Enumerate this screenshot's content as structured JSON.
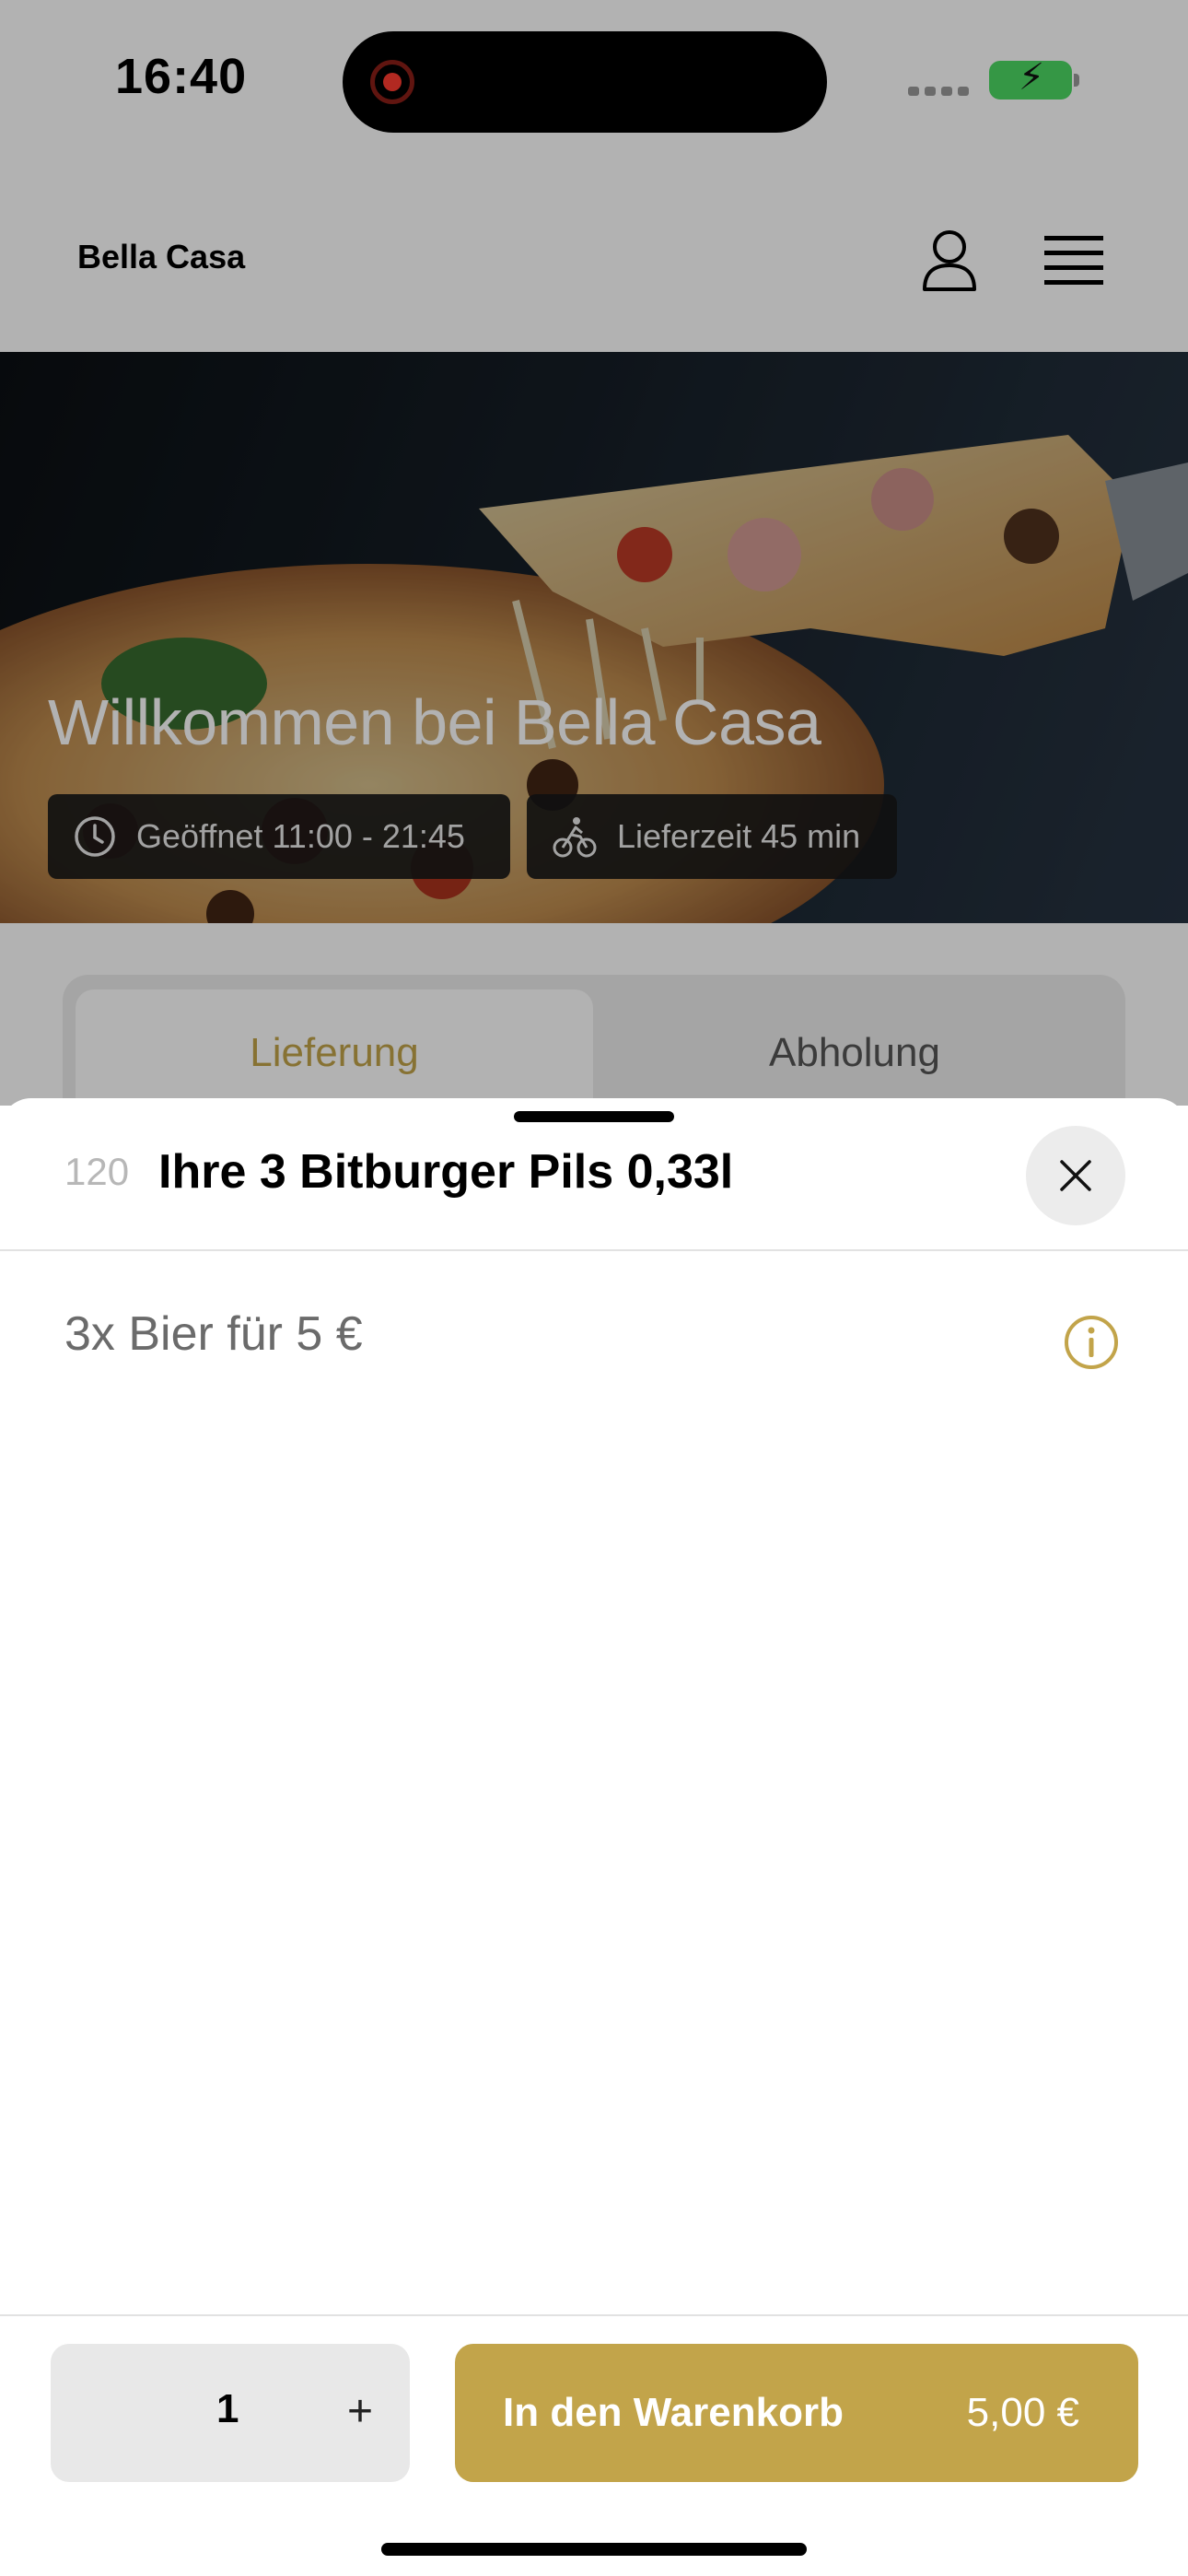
{
  "status_bar": {
    "time": "16:40",
    "recording_icon": "record-icon",
    "battery_icon": "battery-charging-icon"
  },
  "header": {
    "brand": "Bella Casa",
    "account_icon": "user-icon",
    "menu_icon": "menu-icon"
  },
  "hero": {
    "title": "Willkommen bei Bella Casa",
    "opening_hours": "Geöffnet 11:00 - 21:45",
    "delivery_time": "Lieferzeit 45 min",
    "clock_icon": "clock-icon",
    "bike_icon": "bicycle-icon"
  },
  "tabs": [
    {
      "label": "Lieferung",
      "active": true
    },
    {
      "label": "Abholung",
      "active": false
    }
  ],
  "product_sheet": {
    "item_number": "120",
    "title": "Ihre 3 Bitburger Pils 0,33l",
    "description": "3x Bier für 5 €",
    "close_icon": "close-icon",
    "info_icon": "info-icon"
  },
  "footer": {
    "quantity": "1",
    "increment_label": "+",
    "add_to_cart_label": "In den Warenkorb",
    "price": "5,00 €"
  },
  "colors": {
    "accent": "#c2a44a",
    "sheet_bg": "#ffffff",
    "overlay": "rgba(0,0,0,0.30)"
  }
}
